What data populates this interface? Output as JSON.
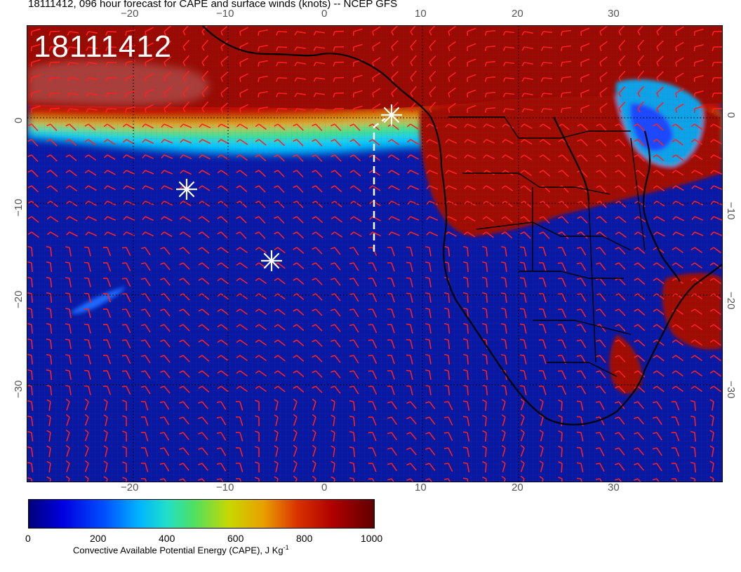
{
  "title": "18111412, 096 hour forecast for CAPE and surface winds (knots) -- NCEP GFS",
  "stamp": "18111412",
  "axes": {
    "x_ticks_top": [
      "−20",
      "−10",
      "0",
      "10",
      "20",
      "30"
    ],
    "x_ticks_bottom": [
      "−20",
      "−10",
      "0",
      "10",
      "20",
      "30"
    ],
    "y_ticks_left": [
      "0",
      "−10",
      "−20",
      "−30"
    ],
    "y_ticks_right": [
      "0",
      "−10",
      "−20",
      "−30"
    ]
  },
  "colorbar": {
    "labels": [
      "0",
      "200",
      "400",
      "600",
      "800",
      "1000"
    ],
    "title": "Convective Available Potential Energy (CAPE), J Kg",
    "title_superscript": "-1",
    "colors": [
      "#00007a",
      "#0000e0",
      "#00b4ff",
      "#50e060",
      "#e8a000",
      "#b00000",
      "#600000"
    ]
  },
  "markers": {
    "color": "#ffffff",
    "icon": "asterisk-icon",
    "count": 3
  },
  "wind_barb_color": "#ff2020",
  "coastline_color": "#000000"
}
